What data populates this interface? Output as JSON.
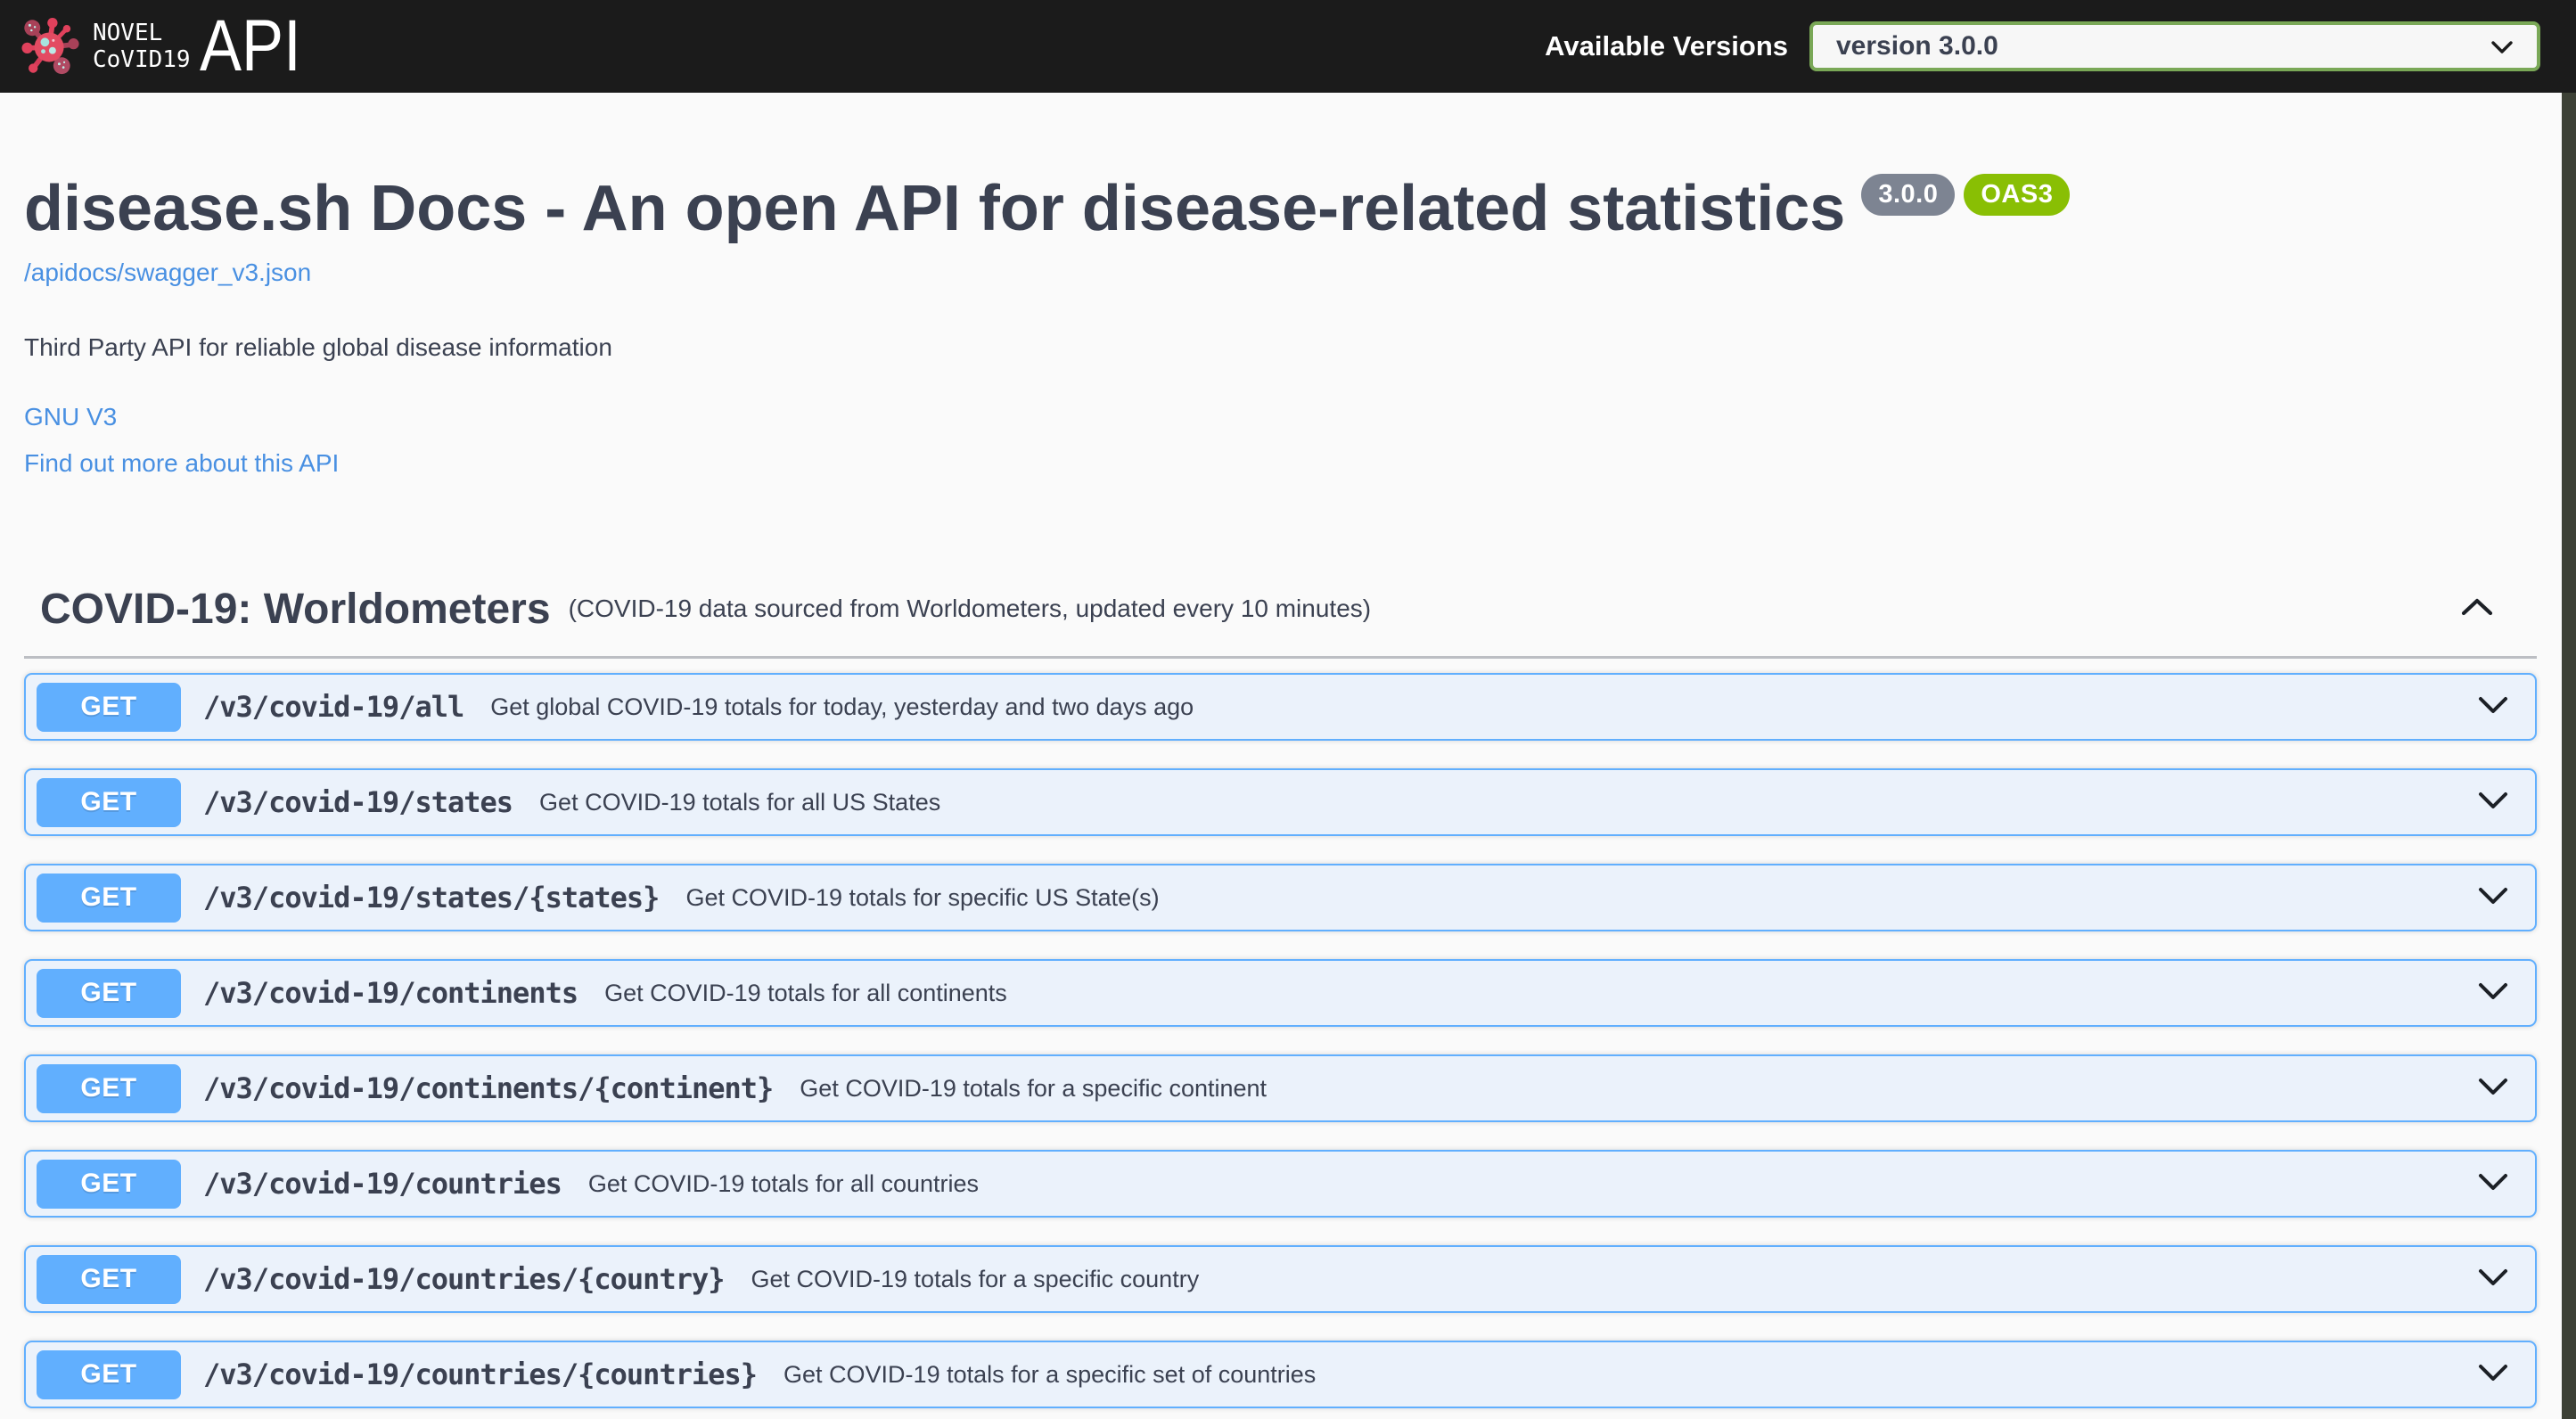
{
  "topbar": {
    "logo_line1": "NOVEL",
    "logo_line2": "CoVID19",
    "logo_api": "API",
    "versions_label": "Available Versions",
    "selected_version": "version 3.0.0"
  },
  "info": {
    "title": "disease.sh Docs - An open API for disease-related statistics",
    "version_badge": "3.0.0",
    "oas_badge": "OAS3",
    "spec_link": "/apidocs/swagger_v3.json",
    "description": "Third Party API for reliable global disease information",
    "license_link": "GNU V3",
    "more_link": "Find out more about this API"
  },
  "tag": {
    "title": "COVID-19: Worldometers",
    "subtitle": "(COVID-19 data sourced from Worldometers, updated every 10 minutes)"
  },
  "endpoints": [
    {
      "method": "GET",
      "path": "/v3/covid-19/all",
      "summary": "Get global COVID-19 totals for today, yesterday and two days ago"
    },
    {
      "method": "GET",
      "path": "/v3/covid-19/states",
      "summary": "Get COVID-19 totals for all US States"
    },
    {
      "method": "GET",
      "path": "/v3/covid-19/states/{states}",
      "summary": "Get COVID-19 totals for specific US State(s)"
    },
    {
      "method": "GET",
      "path": "/v3/covid-19/continents",
      "summary": "Get COVID-19 totals for all continents"
    },
    {
      "method": "GET",
      "path": "/v3/covid-19/continents/{continent}",
      "summary": "Get COVID-19 totals for a specific continent"
    },
    {
      "method": "GET",
      "path": "/v3/covid-19/countries",
      "summary": "Get COVID-19 totals for all countries"
    },
    {
      "method": "GET",
      "path": "/v3/covid-19/countries/{country}",
      "summary": "Get COVID-19 totals for a specific country"
    },
    {
      "method": "GET",
      "path": "/v3/covid-19/countries/{countries}",
      "summary": "Get COVID-19 totals for a specific set of countries"
    }
  ],
  "icons": {
    "logo": "virus-icon",
    "section_collapse": "chevron-up-icon",
    "row_expand": "chevron-down-icon",
    "select_caret": "chevron-down-icon"
  },
  "colors": {
    "page_bg": "#fafafa",
    "topbar_bg": "#1b1b1b",
    "text_dark": "#3b4151",
    "link_blue": "#4990e2",
    "get_blue": "#61affe",
    "row_bg": "#ebf2fb",
    "badge_gray": "#7d8492",
    "badge_green": "#89bf04",
    "select_green": "#7aa857",
    "edge_strip": "#3d4136"
  }
}
